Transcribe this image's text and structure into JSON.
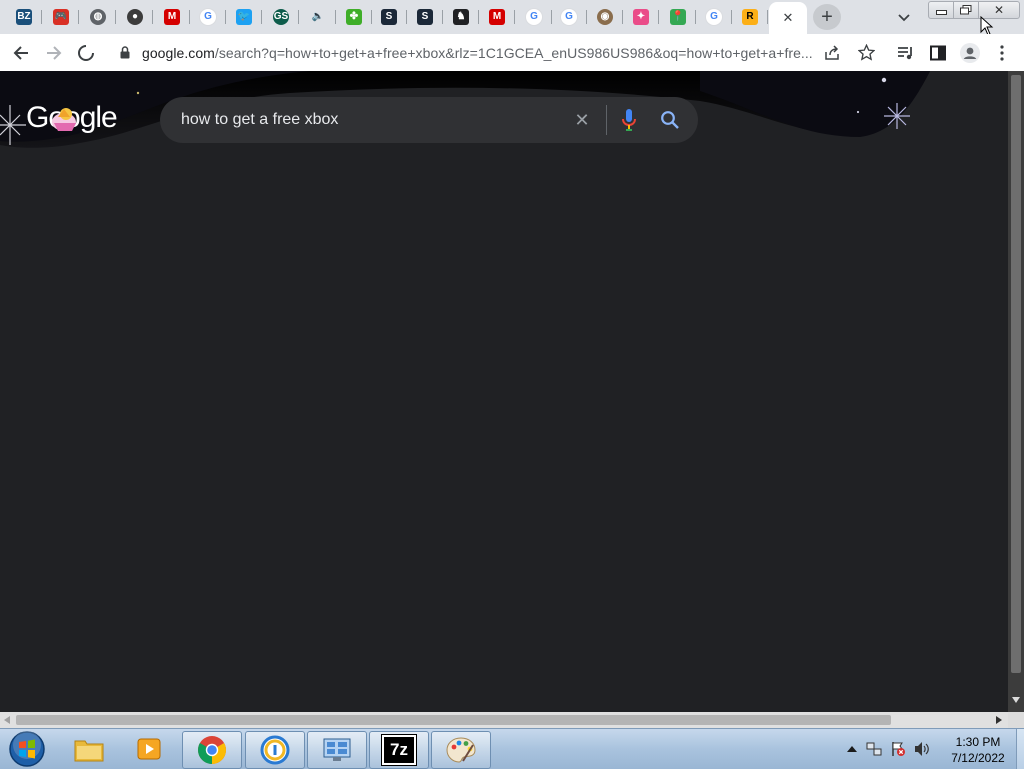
{
  "tabs": [
    {
      "name": "tab-bz-site",
      "icon": "bz-icon",
      "color": "#1a4f7a",
      "glyph": "BZ"
    },
    {
      "name": "tab-gamepad-site",
      "icon": "gamepad-icon",
      "color": "#d93025",
      "glyph": "🎮"
    },
    {
      "name": "tab-globe-site",
      "icon": "globe-icon",
      "color": "#5f6368",
      "glyph": "◍"
    },
    {
      "name": "tab-ninja-site",
      "icon": "ninja-icon",
      "color": "#3c3c3c",
      "glyph": "●"
    },
    {
      "name": "tab-m-site-1",
      "icon": "m-red-icon",
      "color": "#d50000",
      "glyph": "M"
    },
    {
      "name": "tab-google-1",
      "icon": "google-g-icon",
      "color": "#ffffff",
      "glyph": "G"
    },
    {
      "name": "tab-twitter",
      "icon": "twitter-bird-icon",
      "color": "#1da1f2",
      "glyph": "🐦"
    },
    {
      "name": "tab-green-site",
      "icon": "gs-circle-icon",
      "color": "#0d5c4b",
      "glyph": "GS"
    },
    {
      "name": "tab-audio-playing",
      "icon": "speaker-icon",
      "color": "#dee1e6",
      "glyph": "🔈"
    },
    {
      "name": "tab-clover-site",
      "icon": "clover-icon",
      "color": "#3fae29",
      "glyph": "✤"
    },
    {
      "name": "tab-steam-1",
      "icon": "steam-icon",
      "color": "#1b2838",
      "glyph": "S"
    },
    {
      "name": "tab-steam-2",
      "icon": "steam-icon",
      "color": "#1b2838",
      "glyph": "S"
    },
    {
      "name": "tab-puzzle-site",
      "icon": "puzzle-icon",
      "color": "#202124",
      "glyph": "♞"
    },
    {
      "name": "tab-m-site-2",
      "icon": "m-red-icon",
      "color": "#d50000",
      "glyph": "M"
    },
    {
      "name": "tab-google-2",
      "icon": "google-g-icon",
      "color": "#ffffff",
      "glyph": "G"
    },
    {
      "name": "tab-google-3",
      "icon": "google-g-icon",
      "color": "#ffffff",
      "glyph": "G"
    },
    {
      "name": "tab-avatar-site",
      "icon": "avatar-circle-icon",
      "color": "#8a6d4d",
      "glyph": "◉"
    },
    {
      "name": "tab-pinwheel-site",
      "icon": "pinwheel-icon",
      "color": "#ea4c89",
      "glyph": "✦"
    },
    {
      "name": "tab-maps",
      "icon": "maps-pin-icon",
      "color": "#34a853",
      "glyph": "📍"
    },
    {
      "name": "tab-google-4",
      "icon": "google-g-icon",
      "color": "#ffffff",
      "glyph": "G"
    },
    {
      "name": "tab-rockstar",
      "icon": "rockstar-r-icon",
      "color": "#fcaf17",
      "glyph": "R"
    }
  ],
  "active_tab": {
    "close_glyph": "✕"
  },
  "new_tab_glyph": "+",
  "window_controls": {
    "minimize": "—",
    "restore": "❐",
    "close": "✕"
  },
  "toolbar": {
    "url_host": "google.com",
    "url_rest": "/search?q=how+to+get+a+free+xbox&rlz=1C1GCEA_enUS986US986&oq=how+to+get+a+fre..."
  },
  "search": {
    "logo": "Google",
    "query": "how to get a free xbox",
    "clear_glyph": "✕"
  },
  "taskbar": {
    "apps": [
      {
        "name": "taskbar-explorer",
        "icon": "folder-icon"
      },
      {
        "name": "taskbar-media-player",
        "icon": "media-player-icon"
      },
      {
        "name": "taskbar-chrome",
        "icon": "chrome-icon"
      },
      {
        "name": "taskbar-keepass",
        "icon": "keepass-icon"
      },
      {
        "name": "taskbar-control-panel",
        "icon": "control-panel-icon"
      },
      {
        "name": "taskbar-7zip",
        "icon": "7zip-icon",
        "label": "7z"
      },
      {
        "name": "taskbar-paint",
        "icon": "paint-palette-icon"
      }
    ],
    "time": "1:30 PM",
    "date": "7/12/2022"
  },
  "colors": {
    "page_bg": "#202124",
    "searchbox_bg": "#303134",
    "tabstrip_bg": "#dee1e6",
    "mic_blue": "#4285f4",
    "mic_red": "#ea4335",
    "search_icon": "#8ab4f8"
  }
}
